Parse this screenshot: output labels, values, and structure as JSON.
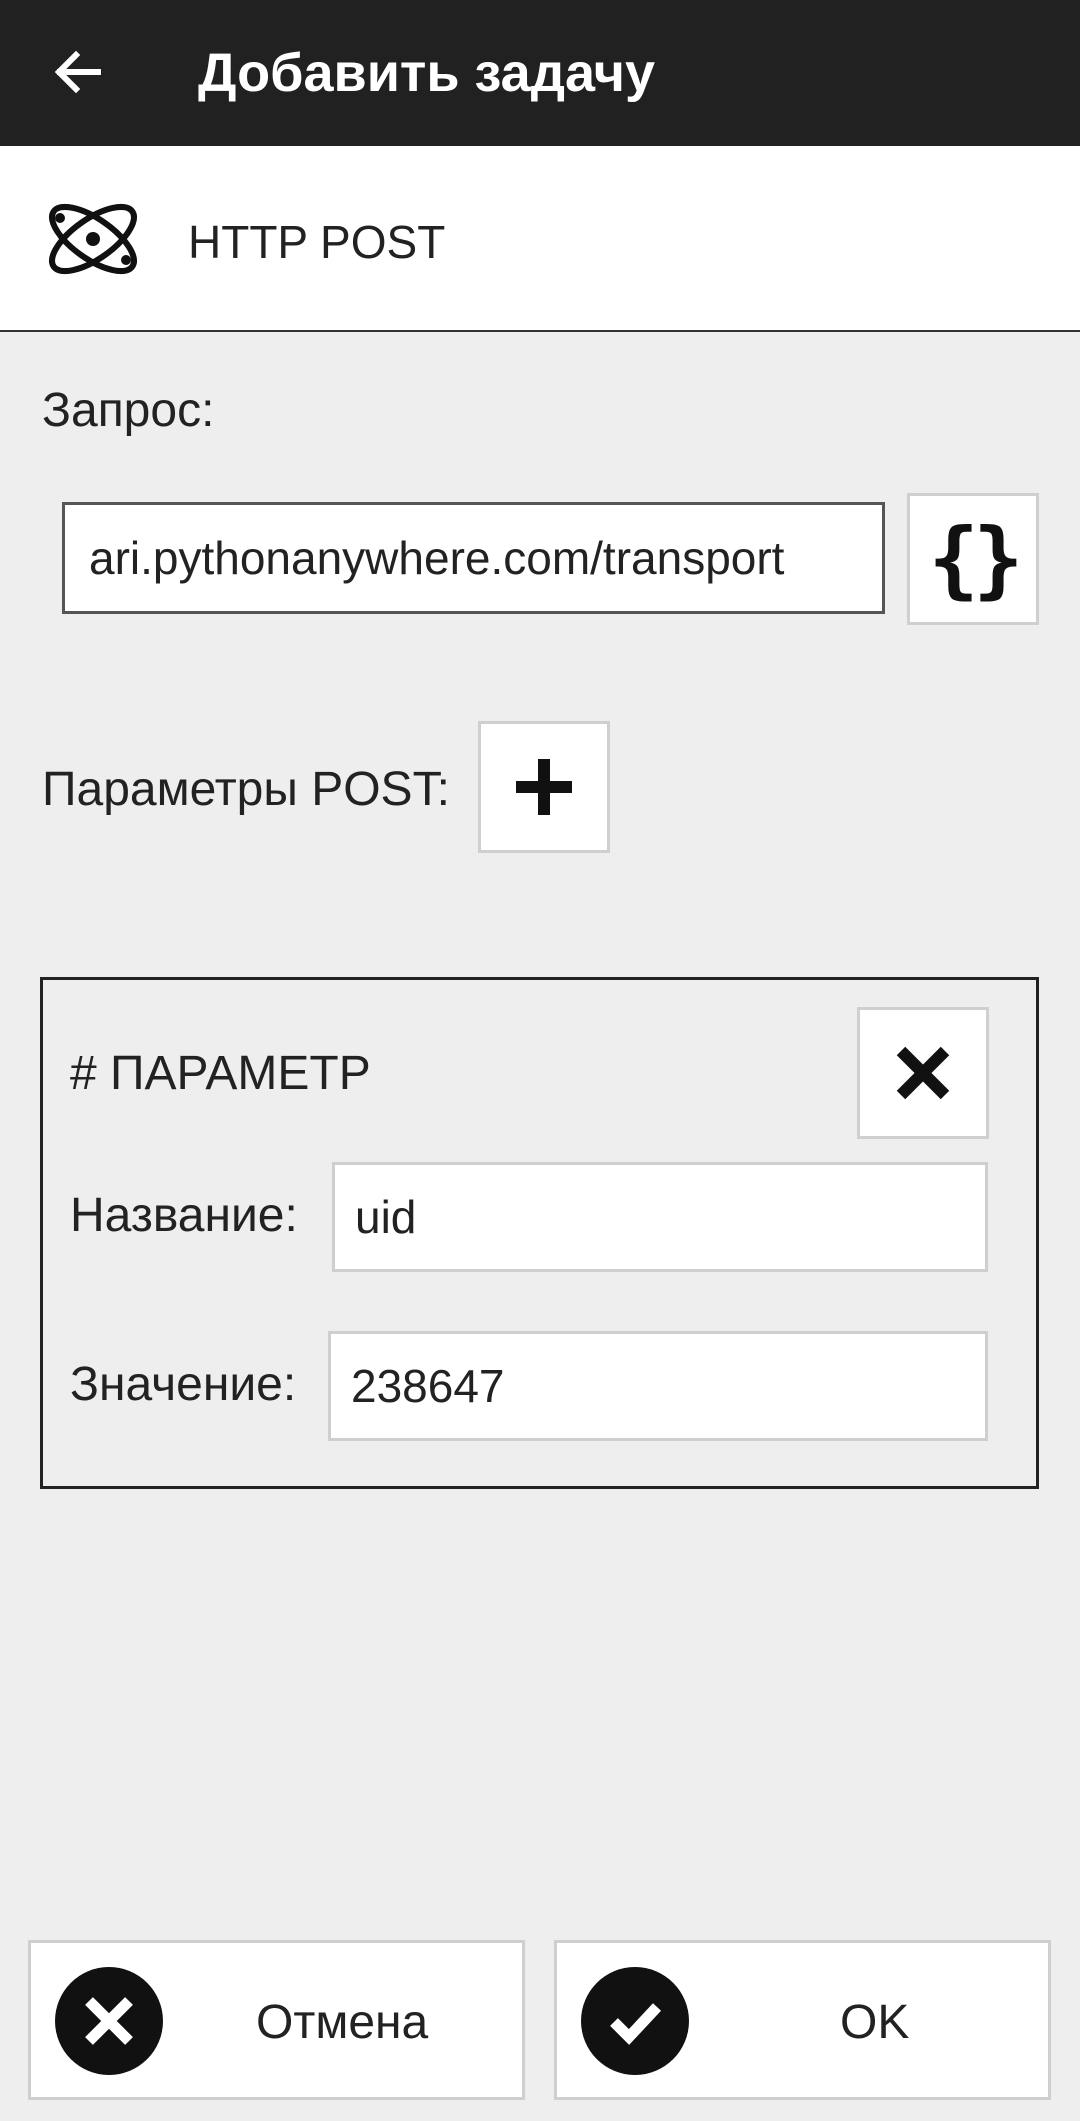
{
  "appbar": {
    "title": "Добавить задачу",
    "back_icon": "arrow-left-icon"
  },
  "task": {
    "icon": "atom-icon",
    "name": "HTTP POST"
  },
  "request": {
    "label": "Запрос:",
    "url_value": "ari.pythonanywhere.com/transport",
    "variables_icon": "curly-braces-icon"
  },
  "post_params": {
    "label": "Параметры POST:",
    "add_icon": "plus-icon"
  },
  "parameter": {
    "header": "# ПАРАМЕТР",
    "remove_icon": "close-icon",
    "name_label": "Название:",
    "name_value": "uid",
    "value_label": "Значение:",
    "value_value": "238647"
  },
  "actions": {
    "cancel_label": "Отмена",
    "cancel_icon": "cancel-circle-icon",
    "ok_label": "OK",
    "ok_icon": "check-circle-icon"
  },
  "colors": {
    "appbar": "#212121",
    "background": "#eeeeee"
  }
}
